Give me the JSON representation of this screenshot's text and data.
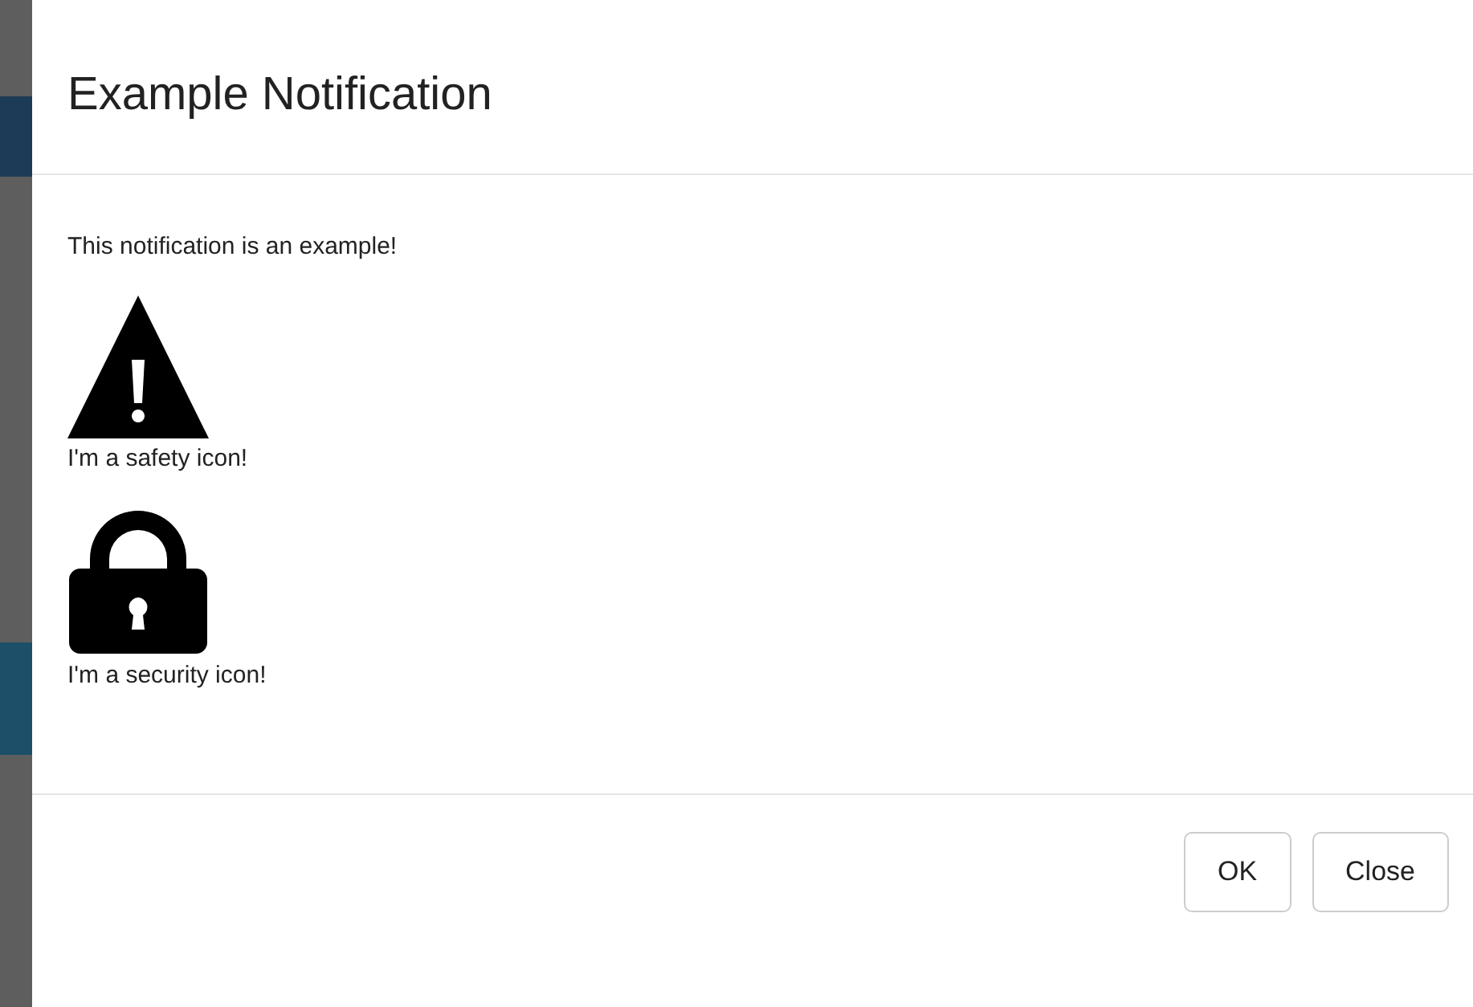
{
  "dialog": {
    "title": "Example Notification",
    "message": "This notification is an example!",
    "items": [
      {
        "kind": "warning",
        "caption": "I'm a safety icon!"
      },
      {
        "kind": "lock",
        "caption": "I'm a security icon!"
      }
    ],
    "buttons": [
      "OK",
      "Close"
    ]
  }
}
